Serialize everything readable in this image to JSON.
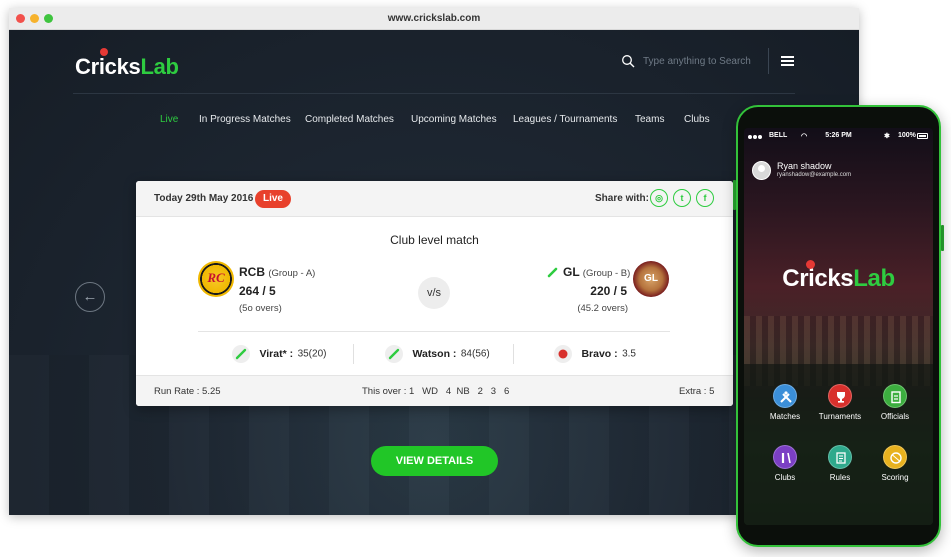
{
  "browser": {
    "url": "www.crickslab.com"
  },
  "site": {
    "logo": {
      "part1": "Cricks",
      "part2": "Lab"
    },
    "search": {
      "placeholder": "Type anything to Search"
    },
    "nav": [
      {
        "label": "Live",
        "active": true
      },
      {
        "label": "In Progress Matches",
        "active": false
      },
      {
        "label": "Completed Matches",
        "active": false
      },
      {
        "label": "Upcoming Matches",
        "active": false
      },
      {
        "label": "Leagues / Tournaments",
        "active": false
      },
      {
        "label": "Teams",
        "active": false
      },
      {
        "label": "Clubs",
        "active": false
      }
    ],
    "prev_arrow": "←",
    "view_details": "VIEW DETAILS"
  },
  "match_card": {
    "date": "Today 29th May 2016",
    "status_badge": "Live",
    "share_label": "Share with:",
    "share_icons": [
      "instagram-icon",
      "twitter-icon",
      "facebook-icon"
    ],
    "title": "Club level match",
    "vs": "v/s",
    "team1": {
      "logo_text": "RC",
      "name": "RCB",
      "group": "(Group - A)",
      "score": "264 / 5",
      "overs": "(5o overs)"
    },
    "team2": {
      "logo_text": "GL",
      "name": "GL",
      "group": "(Group - B)",
      "score": "220 / 5",
      "overs": "(45.2 overs)"
    },
    "players": [
      {
        "name": "Virat* :",
        "score": "35(20)",
        "role": "bat"
      },
      {
        "name": "Watson :",
        "score": "84(56)",
        "role": "bat"
      },
      {
        "name": "Bravo :",
        "score": "3.5",
        "role": "ball"
      }
    ],
    "footer": {
      "run_rate": "Run Rate : 5.25",
      "this_over": "This over : 1   WD   4  NB   2   3   6",
      "extra": "Extra : 5"
    }
  },
  "phone": {
    "status": {
      "carrier": "BELL",
      "time": "5:26 PM",
      "battery": "100%"
    },
    "user": {
      "name": "Ryan shadow",
      "email": "ryanshadow@example.com"
    },
    "logo": {
      "part1": "Cricks",
      "part2": "Lab"
    },
    "menu": [
      {
        "label": "Matches",
        "icon": "matches-icon",
        "color": "#3b8fd9"
      },
      {
        "label": "Turnaments",
        "icon": "trophy-icon",
        "color": "#d8302c"
      },
      {
        "label": "Officials",
        "icon": "clipboard-icon",
        "color": "#3cae3f"
      },
      {
        "label": "Clubs",
        "icon": "bat-icon",
        "color": "#7b3fc4"
      },
      {
        "label": "Rules",
        "icon": "rules-icon",
        "color": "#2fa98c"
      },
      {
        "label": "Scoring",
        "icon": "ball-icon",
        "color": "#e8b21f"
      }
    ]
  },
  "colors": {
    "accent": "#2ecc40",
    "live": "#e8412c",
    "button": "#21c627",
    "site_bg": "#1b232d"
  }
}
